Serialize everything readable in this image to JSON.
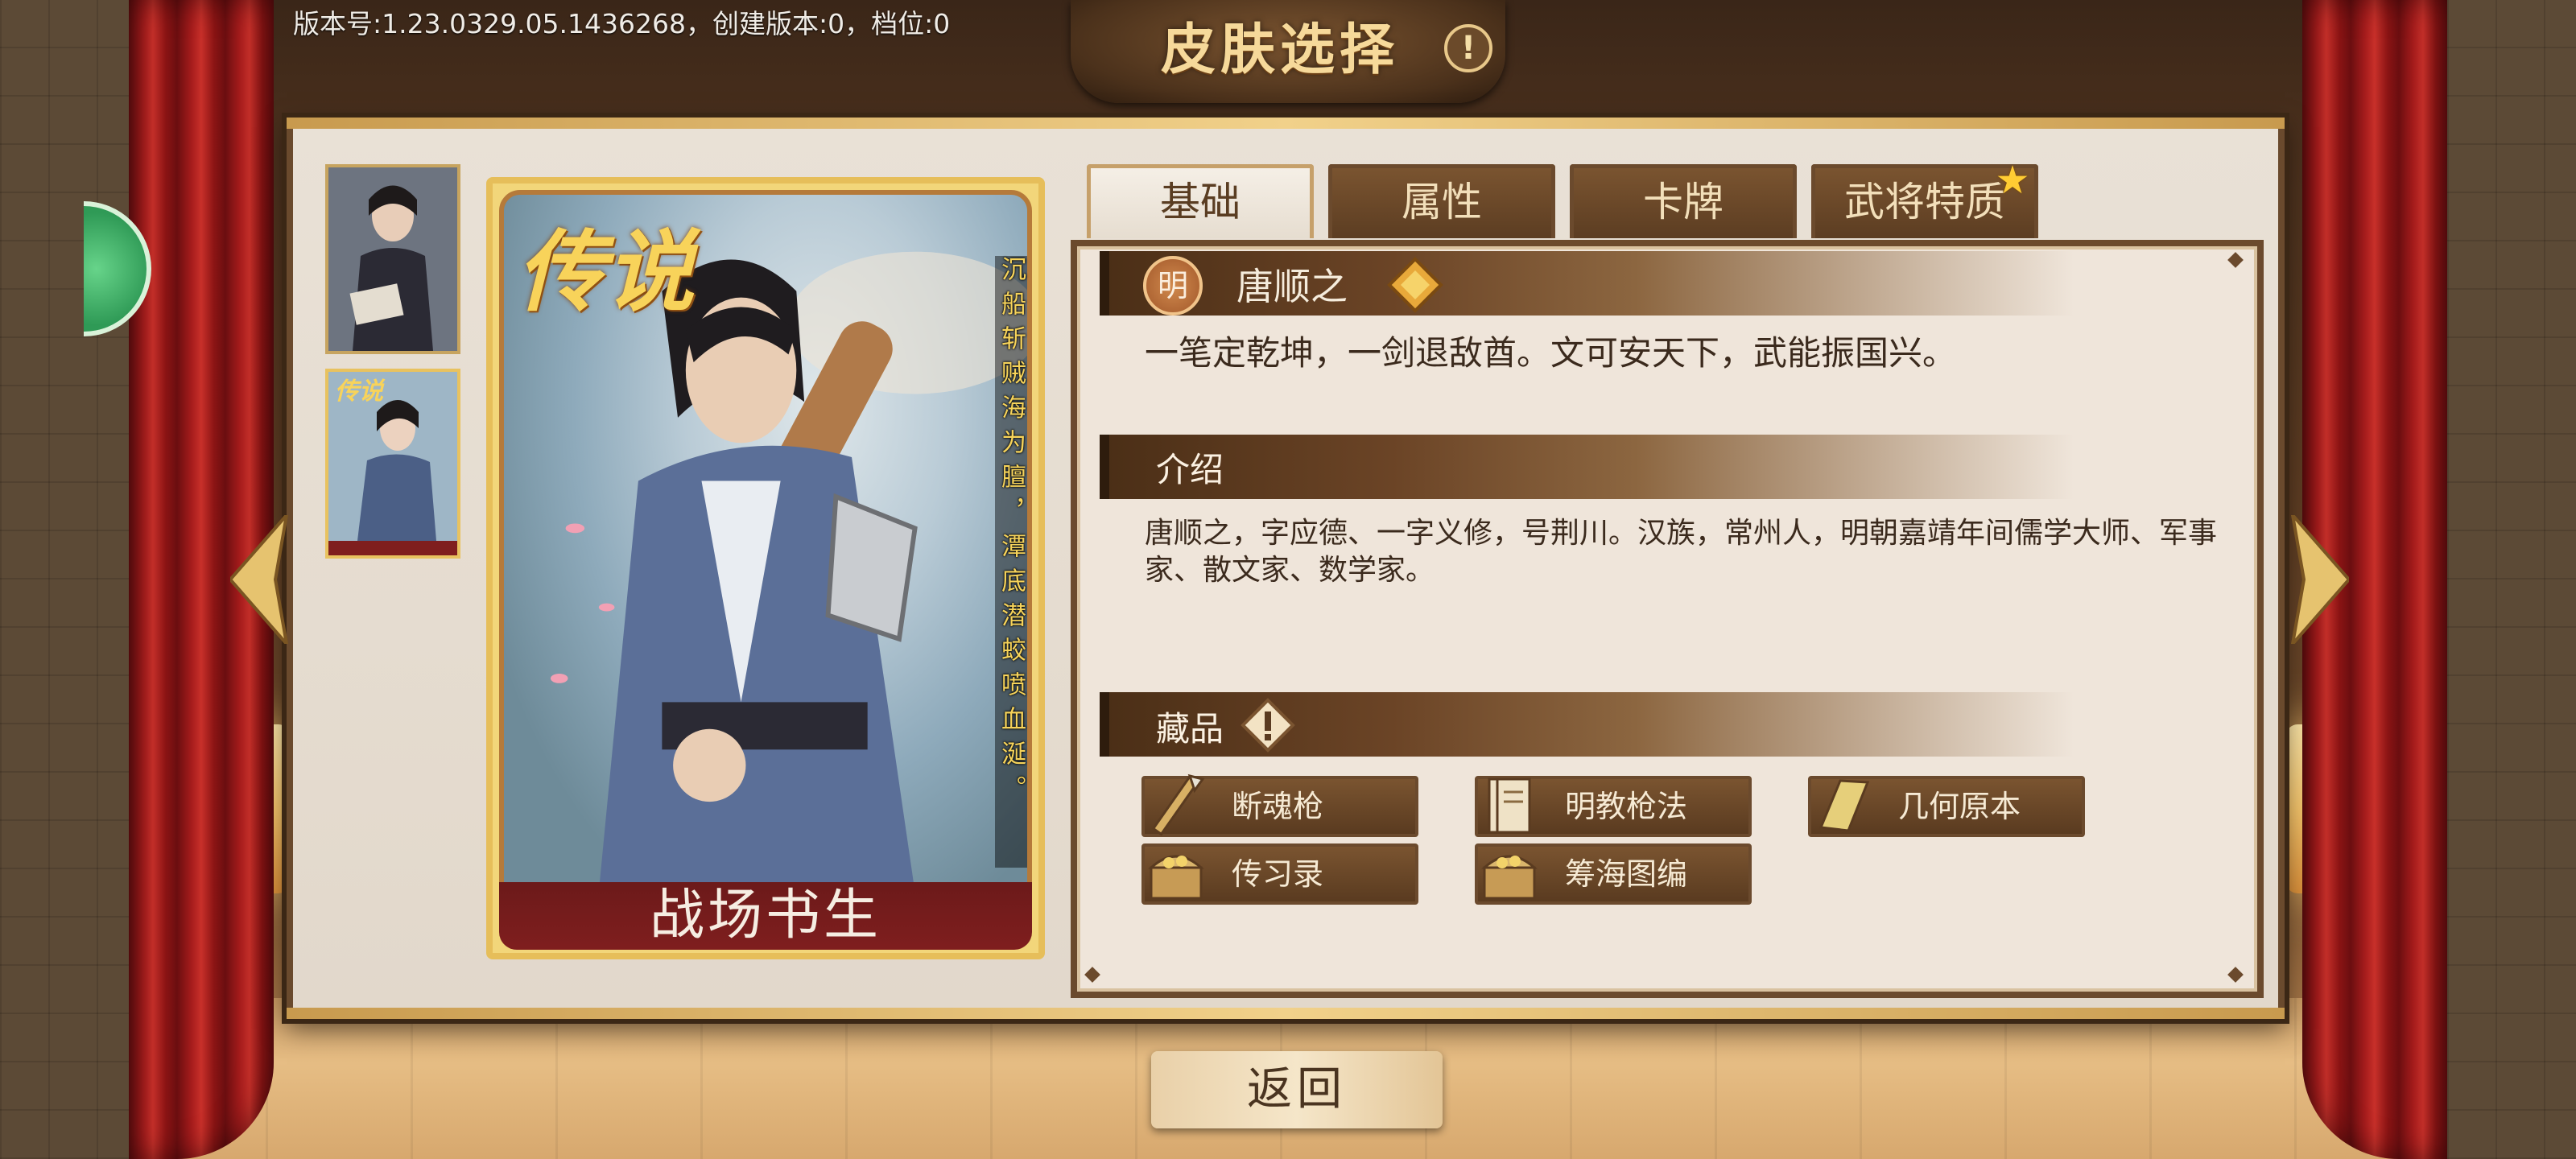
{
  "header": {
    "version_text": "版本号:1.23.0329.05.1436268，创建版本:0，档位:0",
    "title": "皮肤选择",
    "info_icon": "!"
  },
  "card": {
    "legend_label": "传说",
    "skin_name": "战场书生",
    "vertical_text": "沉船斩贼海为膻，潭底潜蛟喷血涎。"
  },
  "tabs": [
    {
      "label": "基础",
      "active": true
    },
    {
      "label": "属性",
      "active": false
    },
    {
      "label": "卡牌",
      "active": false
    },
    {
      "label": "武将特质",
      "active": false
    }
  ],
  "general": {
    "dynasty": "明",
    "name": "唐顺之",
    "quote": "一笔定乾坤，一剑退敌酋。文可安天下，武能振国兴。"
  },
  "intro": {
    "title": "介绍",
    "text": "唐顺之，字应德、一字义修，号荆川。汉族，常州人，明朝嘉靖年间儒学大师、军事家、散文家、数学家。"
  },
  "collection": {
    "title": "藏品",
    "items": [
      {
        "label": "断魂枪",
        "icon": "spear-icon"
      },
      {
        "label": "明教枪法",
        "icon": "book-icon"
      },
      {
        "label": "几何原本",
        "icon": "book-icon"
      },
      {
        "label": "传习录",
        "icon": "chest-icon"
      },
      {
        "label": "筹海图编",
        "icon": "chest-icon"
      }
    ]
  },
  "footer": {
    "return_label": "返回"
  },
  "colors": {
    "panel_border": "#6b4a2d",
    "tab_active_bg": "#f5efe6",
    "card_name_bar": "#7f1e1e"
  }
}
